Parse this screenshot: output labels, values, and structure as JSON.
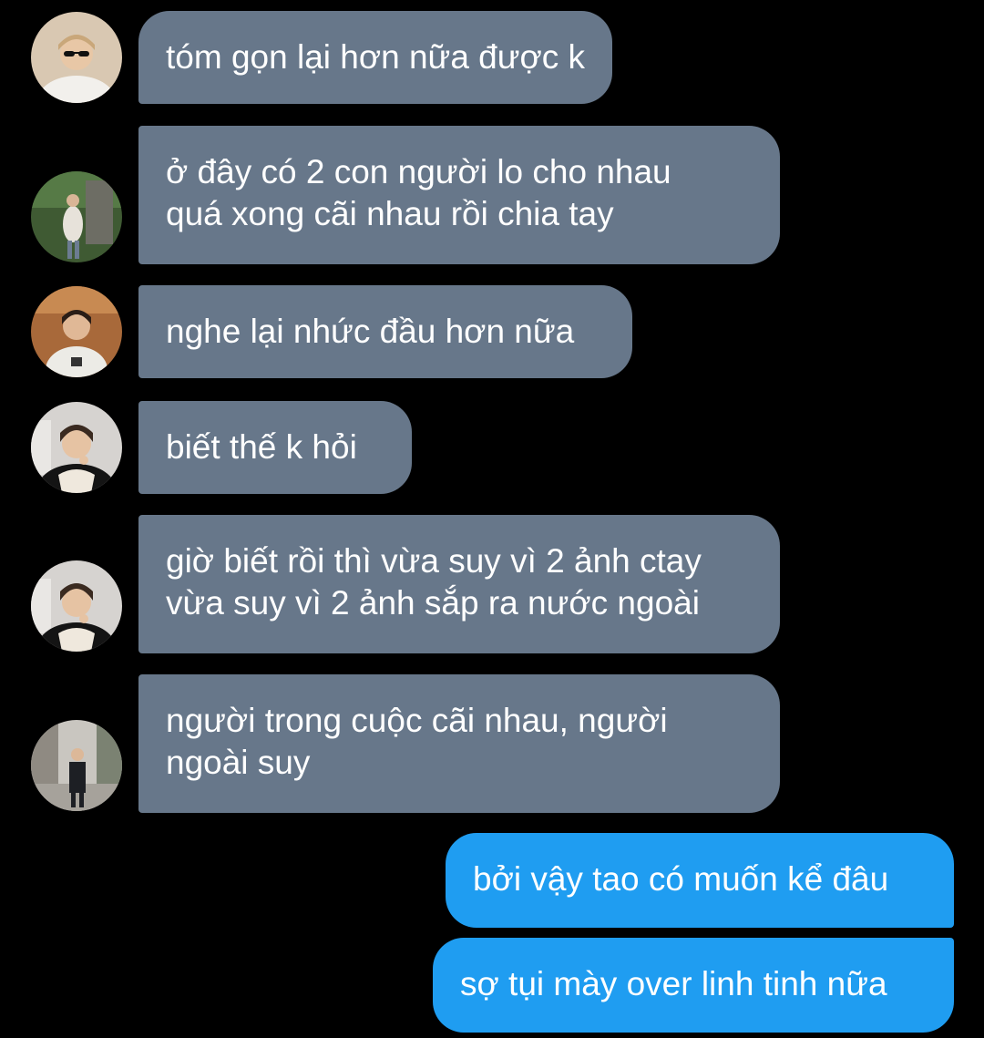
{
  "conversation": {
    "messages": [
      {
        "sender": "other",
        "avatar": "avatar-1",
        "text": "tóm gọn lại hơn nữa được k"
      },
      {
        "sender": "other",
        "avatar": "avatar-2",
        "text": "ở đây có 2 con người lo cho nhau\nquá xong cãi nhau rồi chia tay"
      },
      {
        "sender": "other",
        "avatar": "avatar-3",
        "text": "nghe lại nhức đầu hơn nữa"
      },
      {
        "sender": "other",
        "avatar": "avatar-4",
        "text": "biết thế k hỏi"
      },
      {
        "sender": "other",
        "avatar": "avatar-4",
        "text": "giờ biết rồi thì vừa suy vì 2 ảnh ctay\nvừa suy vì 2 ảnh sắp ra nước ngoài"
      },
      {
        "sender": "other",
        "avatar": "avatar-5",
        "text": "người trong cuộc cãi nhau, người\nngoài suy"
      },
      {
        "sender": "me",
        "text": "bởi vậy tao có muốn kể đâu"
      },
      {
        "sender": "me",
        "text": "sợ tụi mày over linh tinh nữa"
      }
    ]
  },
  "colors": {
    "background": "#000000",
    "incoming_bubble": "#67778a",
    "outgoing_bubble": "#1f9df1",
    "text": "#ffffff"
  }
}
